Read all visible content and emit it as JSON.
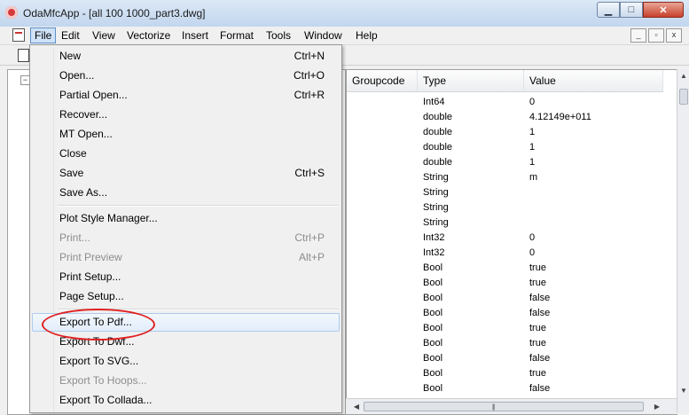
{
  "window": {
    "title": "OdaMfcApp - [all 100 1000_part3.dwg]",
    "min_glyph": "▁",
    "max_glyph": "□",
    "close_glyph": "✕"
  },
  "menubar": {
    "items": [
      "File",
      "Edit",
      "View",
      "Vectorize",
      "Insert",
      "Format",
      "Tools",
      "Window",
      "Help"
    ],
    "mdi_min": "_",
    "mdi_restore": "▫",
    "mdi_close": "x"
  },
  "tree": {
    "toggle": "−"
  },
  "file_menu": {
    "items": [
      {
        "label": "New",
        "shortcut": "Ctrl+N",
        "enabled": true
      },
      {
        "label": "Open...",
        "shortcut": "Ctrl+O",
        "enabled": true
      },
      {
        "label": "Partial Open...",
        "shortcut": "Ctrl+R",
        "enabled": true
      },
      {
        "label": "Recover...",
        "shortcut": "",
        "enabled": true
      },
      {
        "label": "MT Open...",
        "shortcut": "",
        "enabled": true
      },
      {
        "label": "Close",
        "shortcut": "",
        "enabled": true
      },
      {
        "label": "Save",
        "shortcut": "Ctrl+S",
        "enabled": true
      },
      {
        "label": "Save As...",
        "shortcut": "",
        "enabled": true
      },
      {
        "label": "Plot Style Manager...",
        "shortcut": "",
        "enabled": true
      },
      {
        "label": "Print...",
        "shortcut": "Ctrl+P",
        "enabled": false
      },
      {
        "label": "Print Preview",
        "shortcut": "Alt+P",
        "enabled": false
      },
      {
        "label": "Print Setup...",
        "shortcut": "",
        "enabled": true
      },
      {
        "label": "Page Setup...",
        "shortcut": "",
        "enabled": true
      },
      {
        "label": "Export To Pdf...",
        "shortcut": "",
        "enabled": true,
        "highlighted": true
      },
      {
        "label": "Export To Dwf...",
        "shortcut": "",
        "enabled": true
      },
      {
        "label": "Export To SVG...",
        "shortcut": "",
        "enabled": true
      },
      {
        "label": "Export To Hoops...",
        "shortcut": "",
        "enabled": false
      },
      {
        "label": "Export To Collada...",
        "shortcut": "",
        "enabled": true
      }
    ]
  },
  "grid": {
    "columns": [
      "Groupcode",
      "Type",
      "Value"
    ],
    "rows": [
      {
        "type": "Int64",
        "value": "0"
      },
      {
        "type": "double",
        "value": "4.12149e+011"
      },
      {
        "type": "double",
        "value": "1"
      },
      {
        "type": "double",
        "value": "1"
      },
      {
        "type": "double",
        "value": "1"
      },
      {
        "type": "String",
        "value": "m"
      },
      {
        "type": "String",
        "value": ""
      },
      {
        "type": "String",
        "value": ""
      },
      {
        "type": "String",
        "value": ""
      },
      {
        "type": "Int32",
        "value": "0"
      },
      {
        "type": "Int32",
        "value": "0"
      },
      {
        "type": "Bool",
        "value": "true"
      },
      {
        "type": "Bool",
        "value": "true"
      },
      {
        "type": "Bool",
        "value": "false"
      },
      {
        "type": "Bool",
        "value": "false"
      },
      {
        "type": "Bool",
        "value": "true"
      },
      {
        "type": "Bool",
        "value": "true"
      },
      {
        "type": "Bool",
        "value": "false"
      },
      {
        "type": "Bool",
        "value": "true"
      },
      {
        "type": "Bool",
        "value": "false"
      }
    ]
  },
  "scroll": {
    "up": "▲",
    "down": "▼",
    "left": "◀",
    "right": "▶",
    "grip": "|||"
  },
  "colors": {
    "highlight_ring": "#e02020",
    "menu_hover": "#e3eefb",
    "disabled_text": "#8d8d8d"
  }
}
